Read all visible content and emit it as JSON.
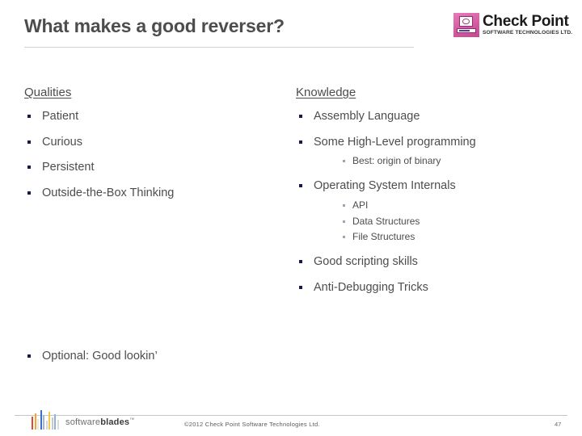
{
  "slide": {
    "title": "What makes a good reverser?",
    "brand": {
      "name": "Check Point",
      "tagline": "SOFTWARE TECHNOLOGIES LTD.",
      "mark_icon": "computer-monitor-icon",
      "mark_color": "#d45ba2"
    },
    "columns": {
      "left": {
        "heading": "Qualities",
        "items": [
          {
            "label": "Patient"
          },
          {
            "label": "Curious"
          },
          {
            "label": "Persistent"
          },
          {
            "label": "Outside-the-Box Thinking"
          }
        ]
      },
      "right": {
        "heading": "Knowledge",
        "items": [
          {
            "label": "Assembly Language",
            "sub": []
          },
          {
            "label": "Some High-Level programming",
            "sub": [
              "Best: origin of binary"
            ]
          },
          {
            "label": "Operating System Internals",
            "sub": [
              "API",
              "Data Structures",
              "File Structures"
            ]
          },
          {
            "label": "Good scripting skills",
            "sub": []
          },
          {
            "label": "Anti-Debugging Tricks",
            "sub": []
          }
        ]
      }
    },
    "optional": "Optional: Good lookin’"
  },
  "footer": {
    "logo_text_light": "software",
    "logo_text_bold": "blades",
    "logo_trademark": "™",
    "copyright": "©2012 Check Point Software Technologies Ltd.",
    "page_number": "47",
    "bar_colors": [
      "#e0492f",
      "#f0a53a",
      "#e8e8e8",
      "#3a6fc4",
      "#9fb8dd",
      "#d8d8d8",
      "#f2c94c",
      "#c9c9c9",
      "#8fb3d9",
      "#dcdcdc"
    ]
  },
  "colors": {
    "title": "#4d4d4d",
    "body_text": "#4d4d4d",
    "bullet_level1": "#131a52",
    "bullet_level2": "#9aa3b8",
    "rule": "#d2d2d2"
  }
}
